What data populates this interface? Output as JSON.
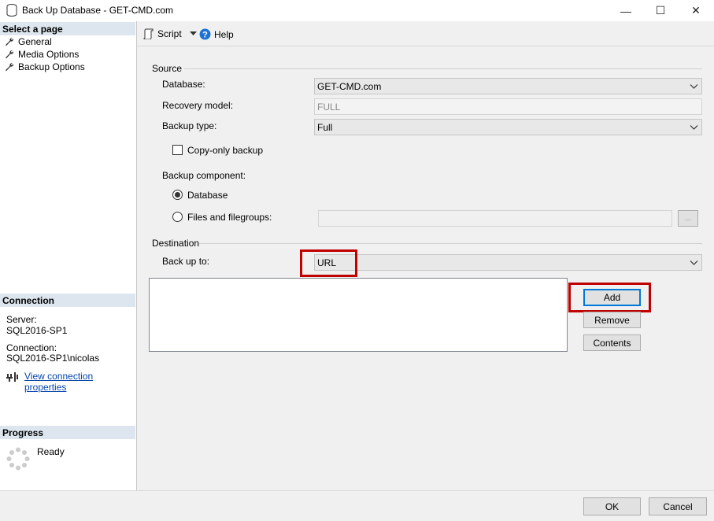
{
  "window": {
    "title": "Back Up Database - GET-CMD.com",
    "minimize": "—",
    "maximize": "☐",
    "close": "✕"
  },
  "sidebar": {
    "select_page_header": "Select a page",
    "pages": [
      {
        "label": "General",
        "icon": "wrench-icon",
        "selected": true
      },
      {
        "label": "Media Options",
        "icon": "wrench-icon"
      },
      {
        "label": "Backup Options",
        "icon": "wrench-icon"
      }
    ],
    "connection_header": "Connection",
    "server_label": "Server:",
    "server_value": "SQL2016-SP1",
    "connection_label": "Connection:",
    "connection_value": "SQL2016-SP1\\nicolas",
    "view_properties_link": "View connection properties",
    "progress_header": "Progress",
    "progress_status": "Ready"
  },
  "toolbar": {
    "script_label": "Script",
    "help_label": "Help"
  },
  "source": {
    "group_label": "Source",
    "database_label": "Database:",
    "database_value": "GET-CMD.com",
    "recovery_label": "Recovery model:",
    "recovery_value": "FULL",
    "backup_type_label": "Backup type:",
    "backup_type_value": "Full",
    "copy_only_label": "Copy-only backup",
    "copy_only_checked": false,
    "component_label": "Backup component:",
    "component_database_label": "Database",
    "component_files_label": "Files and filegroups:",
    "component_selected": "Database",
    "browse_label": "..."
  },
  "destination": {
    "group_label": "Destination",
    "backup_to_label": "Back up to:",
    "backup_to_value": "URL",
    "add_label": "Add",
    "remove_label": "Remove",
    "contents_label": "Contents",
    "items": []
  },
  "footer": {
    "ok_label": "OK",
    "cancel_label": "Cancel"
  },
  "colors": {
    "highlight_red": "#c00000",
    "link_blue": "#0645ad",
    "focus_blue": "#0078d7",
    "header_bg": "#dde6ef"
  }
}
